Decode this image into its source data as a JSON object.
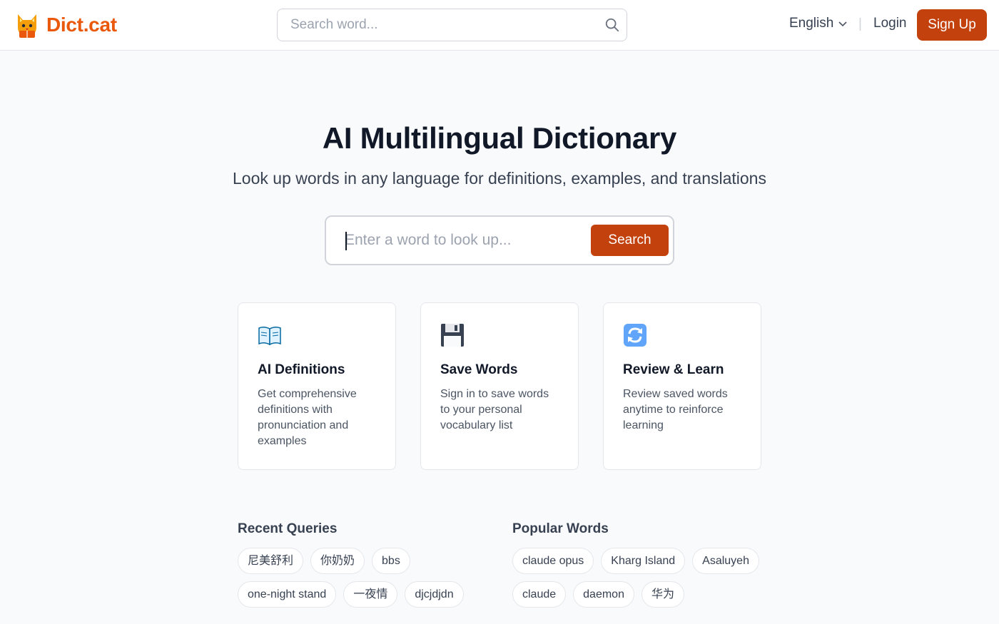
{
  "brand": {
    "name": "Dict.cat"
  },
  "header": {
    "search_placeholder": "Search word...",
    "language": "English",
    "separator": "|",
    "login": "Login",
    "signup": "Sign Up"
  },
  "hero": {
    "title": "AI Multilingual Dictionary",
    "subtitle": "Look up words in any language for definitions, examples, and translations",
    "search_placeholder": "Enter a word to look up...",
    "search_button": "Search"
  },
  "features": [
    {
      "icon": "book-icon",
      "title": "AI Definitions",
      "text": "Get comprehensive definitions with pronunciation and examples"
    },
    {
      "icon": "floppy-disk-icon",
      "title": "Save Words",
      "text": "Sign in to save words to your personal vocabulary list"
    },
    {
      "icon": "refresh-icon",
      "title": "Review & Learn",
      "text": "Review saved words anytime to reinforce learning"
    }
  ],
  "recent": {
    "title": "Recent Queries",
    "tags": [
      "尼美舒利",
      "你奶奶",
      "bbs",
      "one-night stand",
      "一夜情",
      "djcjdjdn"
    ]
  },
  "popular": {
    "title": "Popular Words",
    "tags": [
      "claude opus",
      "Kharg Island",
      "Asaluyeh",
      "claude",
      "daemon",
      "华为"
    ]
  },
  "colors": {
    "brand": "#ea580c",
    "primary": "#c2410c",
    "background": "#f9fafb"
  }
}
